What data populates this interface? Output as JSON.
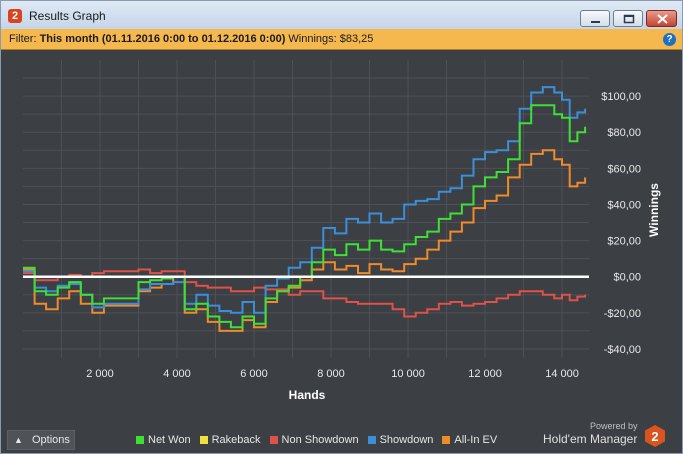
{
  "window": {
    "title": "Results Graph",
    "app_icon_text": "2",
    "buttons": [
      "minimize-icon",
      "maximize-icon",
      "close-icon"
    ]
  },
  "filter": {
    "prefix": "Filter:",
    "period": "This month (01.11.2016 0:00 to 01.12.2016 0:00)",
    "winnings": "Winnings: $83,25",
    "help_icon": "?"
  },
  "footer": {
    "options_label": "Options",
    "powered_by": "Powered by",
    "brand": "Hold'em Manager",
    "brand_logo_text": "2"
  },
  "colors": {
    "background": "#3c3f43",
    "grid": "#4e5156",
    "zero_line": "#ffffff",
    "net_won": "#3fe035",
    "rakeback": "#f0e040",
    "non_showdown": "#e0514a",
    "showdown": "#3b8fd9",
    "all_in_ev": "#f08a2a"
  },
  "chart_data": {
    "type": "line",
    "xlabel": "Hands",
    "ylabel": "Winnings",
    "xlim": [
      0,
      14700
    ],
    "ylim": [
      -45,
      120
    ],
    "x_ticks": [
      2000,
      4000,
      6000,
      8000,
      10000,
      12000,
      14000
    ],
    "x_tick_labels": [
      "2 000",
      "4 000",
      "6 000",
      "8 000",
      "10 000",
      "12 000",
      "14 000"
    ],
    "y_ticks": [
      -40,
      -20,
      0,
      20,
      40,
      60,
      80,
      100
    ],
    "y_tick_labels": [
      "-$40,00",
      "-$20,00",
      "$0,00",
      "$20,00",
      "$40,00",
      "$60,00",
      "$80,00",
      "$100,00"
    ],
    "grid": true,
    "legend_position": "bottom",
    "x": [
      0,
      300,
      600,
      900,
      1200,
      1500,
      1800,
      2100,
      2400,
      2700,
      3000,
      3300,
      3600,
      3900,
      4200,
      4500,
      4800,
      5100,
      5400,
      5700,
      6000,
      6300,
      6600,
      6900,
      7200,
      7500,
      7800,
      8100,
      8400,
      8700,
      9000,
      9300,
      9600,
      9900,
      10200,
      10500,
      10800,
      11100,
      11400,
      11700,
      12000,
      12300,
      12600,
      12900,
      13200,
      13500,
      13800,
      14000,
      14200,
      14400,
      14600
    ],
    "series": [
      {
        "name": "Net Won",
        "color": "#3fe035",
        "values": [
          5,
          -8,
          -10,
          -6,
          -3,
          -10,
          -15,
          -12,
          -12,
          -12,
          -3,
          -2,
          -1,
          0,
          -18,
          -15,
          -22,
          -25,
          -28,
          -22,
          -26,
          -12,
          -8,
          -5,
          0,
          8,
          15,
          12,
          18,
          15,
          20,
          15,
          14,
          18,
          22,
          25,
          32,
          35,
          40,
          50,
          55,
          58,
          65,
          85,
          95,
          95,
          90,
          88,
          75,
          80,
          83
        ]
      },
      {
        "name": "Rakeback",
        "color": "#f0e040",
        "values": [
          0,
          0,
          0,
          0,
          0,
          0,
          0,
          0,
          0,
          0,
          0,
          0,
          0,
          0,
          0,
          0,
          0,
          0,
          0,
          0,
          0,
          0,
          0,
          0,
          0,
          0,
          0,
          0,
          0,
          0,
          0,
          0,
          0,
          0,
          0,
          0,
          0,
          0,
          0,
          0,
          0,
          0,
          0,
          0,
          0,
          0,
          0,
          0,
          0,
          0,
          0
        ]
      },
      {
        "name": "Non Showdown",
        "color": "#e0514a",
        "values": [
          2,
          -2,
          -2,
          0,
          1,
          0,
          2,
          3,
          3,
          3,
          4,
          2,
          3,
          3,
          -3,
          -5,
          -6,
          -6,
          -8,
          -8,
          -6,
          -7,
          -7,
          -10,
          -8,
          -8,
          -12,
          -12,
          -14,
          -15,
          -15,
          -15,
          -18,
          -22,
          -20,
          -18,
          -15,
          -14,
          -16,
          -15,
          -14,
          -12,
          -10,
          -8,
          -8,
          -10,
          -12,
          -10,
          -13,
          -11,
          -10
        ]
      },
      {
        "name": "Showdown",
        "color": "#3b8fd9",
        "values": [
          3,
          -6,
          -8,
          -5,
          -4,
          -10,
          -17,
          -15,
          -15,
          -15,
          -7,
          -4,
          -4,
          -3,
          -15,
          -10,
          -16,
          -19,
          -20,
          -14,
          -20,
          -5,
          -1,
          5,
          8,
          16,
          27,
          24,
          32,
          30,
          35,
          30,
          32,
          40,
          42,
          43,
          47,
          49,
          56,
          65,
          69,
          70,
          75,
          93,
          102,
          105,
          102,
          98,
          88,
          91,
          93
        ]
      },
      {
        "name": "All-In EV",
        "color": "#f08a2a",
        "values": [
          4,
          -15,
          -18,
          -12,
          -8,
          -15,
          -20,
          -16,
          -16,
          -16,
          -8,
          -6,
          -4,
          0,
          -20,
          -18,
          -25,
          -30,
          -30,
          -24,
          -28,
          -14,
          -8,
          -6,
          -2,
          4,
          8,
          4,
          6,
          2,
          7,
          4,
          3,
          7,
          10,
          15,
          20,
          25,
          30,
          38,
          42,
          45,
          55,
          62,
          68,
          70,
          65,
          62,
          50,
          52,
          55
        ]
      }
    ]
  }
}
